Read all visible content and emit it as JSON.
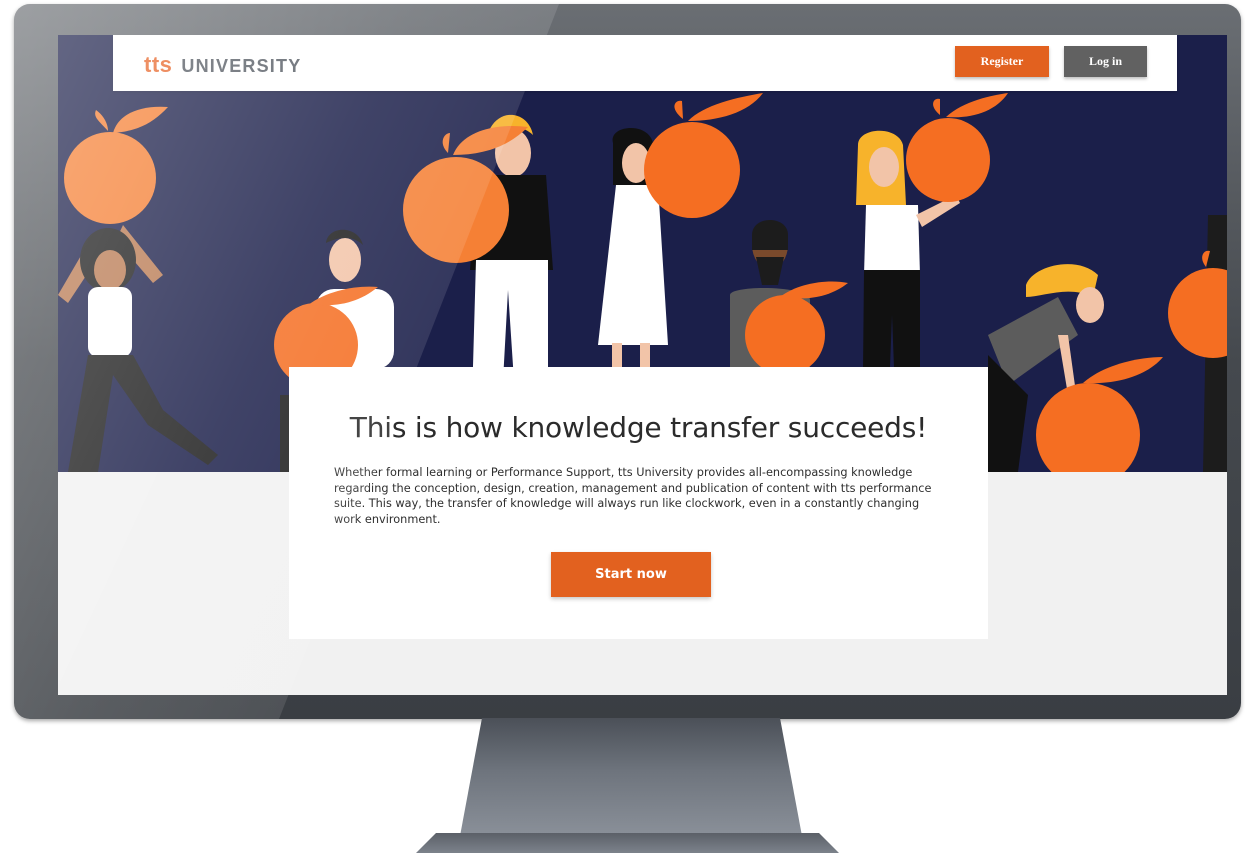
{
  "header": {
    "logo_brand": "tts",
    "logo_sub": "UNIVERSITY",
    "register_label": "Register",
    "login_label": "Log in"
  },
  "hero_card": {
    "title": "This is how knowledge transfer succeeds!",
    "description": "Whether formal learning or Performance Support, tts University provides all-encompassing knowledge regarding the conception, design, creation, management and publication of content with tts performance suite. This way, the transfer of knowledge will always run like clockwork, even in a constantly changing work environment.",
    "cta_label": "Start now"
  },
  "colors": {
    "accent": "#e2611f",
    "hero_background": "#1b1f4a",
    "login_button": "#616161",
    "page_background": "#f1f1f1"
  }
}
